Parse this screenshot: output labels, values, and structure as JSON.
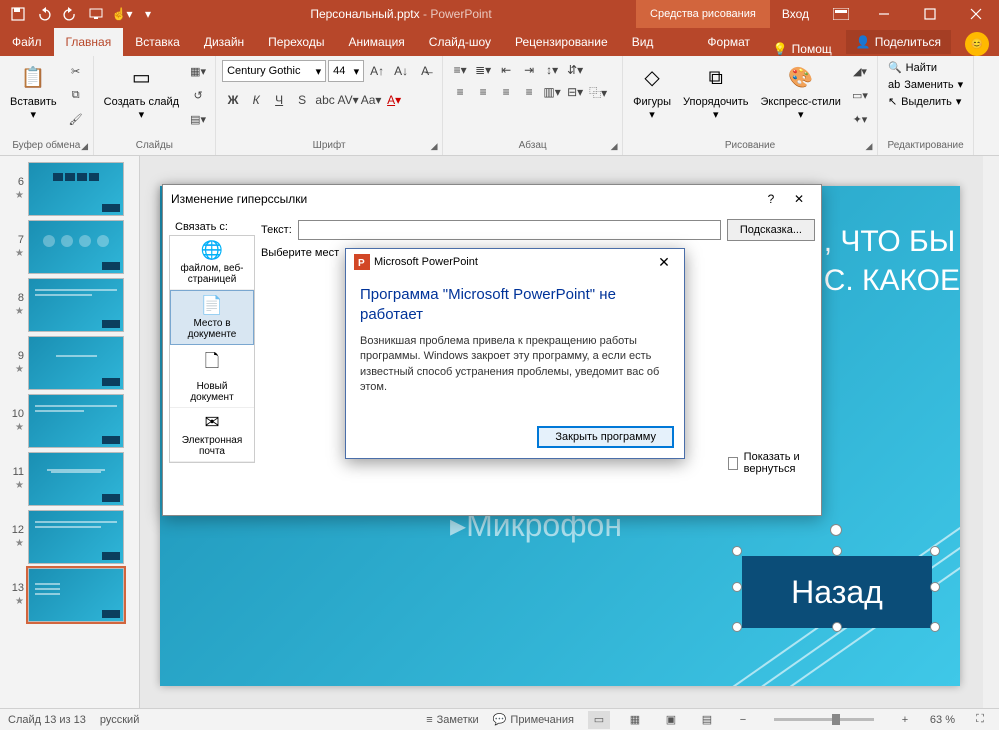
{
  "title": {
    "filename": "Персональный.pptx",
    "app": "PowerPoint",
    "contextual_tab": "Средства рисования",
    "login": "Вход"
  },
  "tabs": {
    "file": "Файл",
    "home": "Главная",
    "insert": "Вставка",
    "design": "Дизайн",
    "transitions": "Переходы",
    "animations": "Анимация",
    "slideshow": "Слайд-шоу",
    "review": "Рецензирование",
    "view": "Вид",
    "format": "Формат"
  },
  "tellme": "Помощ",
  "share": "Поделиться",
  "ribbon": {
    "clipboard": {
      "label": "Буфер обмена",
      "paste": "Вставить"
    },
    "slides": {
      "label": "Слайды",
      "new_slide": "Создать слайд"
    },
    "font": {
      "label": "Шрифт",
      "name": "Century Gothic",
      "size": "44"
    },
    "paragraph": {
      "label": "Абзац"
    },
    "drawing": {
      "label": "Рисование",
      "shapes": "Фигуры",
      "arrange": "Упорядочить",
      "styles": "Экспресс-стили"
    },
    "editing": {
      "label": "Редактирование",
      "find": "Найти",
      "replace": "Заменить",
      "select": "Выделить"
    }
  },
  "thumbnails": [
    {
      "num": "6"
    },
    {
      "num": "7"
    },
    {
      "num": "8"
    },
    {
      "num": "9"
    },
    {
      "num": "10"
    },
    {
      "num": "11"
    },
    {
      "num": "12"
    },
    {
      "num": "13"
    }
  ],
  "slide": {
    "partial_text_1": ", ЧТО БЫ",
    "partial_text_2": "С. КАКОЕ",
    "mic_label": "Микрофон",
    "back_button": "Назад"
  },
  "status": {
    "slide_n": "Слайд 13 из 13",
    "lang": "русский",
    "notes": "Заметки",
    "comments": "Примечания",
    "zoom": "63 %"
  },
  "hyperlink_dialog": {
    "title": "Изменение гиперссылки",
    "link_to_label": "Связать с:",
    "text_label": "Текст:",
    "hint_button": "Подсказка...",
    "select_label": "Выберите мест",
    "types": {
      "file_web": "файлом, веб-страницей",
      "place": "Место в документе",
      "new_doc": "Новый документ",
      "email": "Электронная почта"
    },
    "show_return": "Показать и вернуться"
  },
  "error_dialog": {
    "title": "Microsoft PowerPoint",
    "heading": "Программа \"Microsoft PowerPoint\" не работает",
    "body": "Возникшая проблема привела к прекращению работы программы. Windows закроет эту программу, а если есть известный способ устранения проблемы, уведомит вас об этом.",
    "close_button": "Закрыть программу"
  }
}
